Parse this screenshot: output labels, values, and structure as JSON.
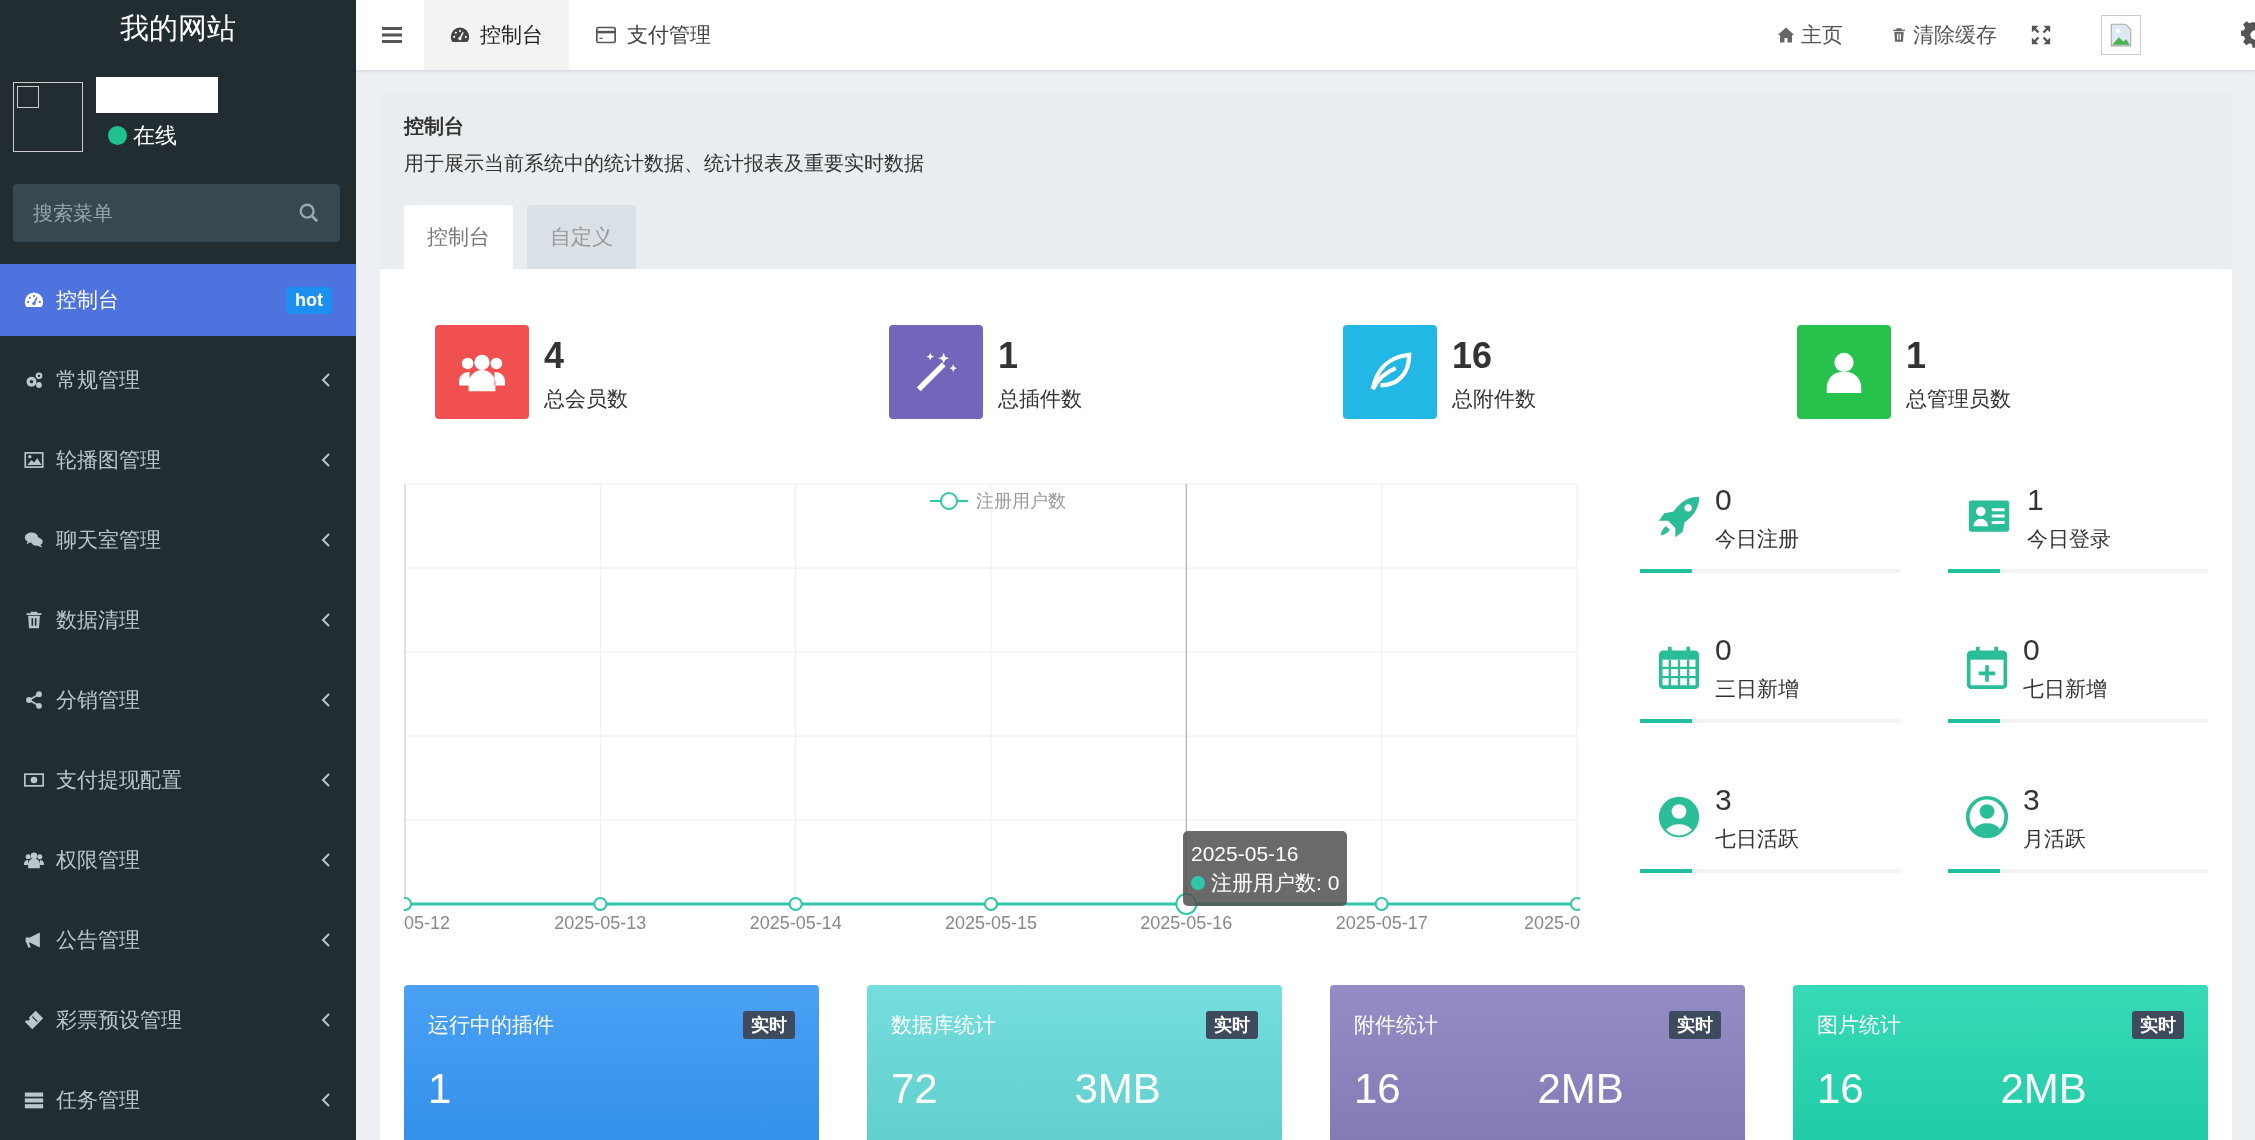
{
  "sidebar": {
    "title": "我的网站",
    "user": {
      "status": "在线"
    },
    "search": {
      "placeholder": "搜索菜单"
    },
    "items": [
      {
        "label": "控制台",
        "kind": "link",
        "badge": "hot",
        "selected": true
      },
      {
        "label": "常规管理",
        "kind": "submenu",
        "selected": false
      },
      {
        "label": "轮播图管理",
        "kind": "submenu",
        "selected": false
      },
      {
        "label": "聊天室管理",
        "kind": "submenu",
        "selected": false
      },
      {
        "label": "数据清理",
        "kind": "submenu",
        "selected": false
      },
      {
        "label": "分销管理",
        "kind": "submenu",
        "selected": false
      },
      {
        "label": "支付提现配置",
        "kind": "submenu",
        "selected": false
      },
      {
        "label": "权限管理",
        "kind": "submenu",
        "selected": false
      },
      {
        "label": "公告管理",
        "kind": "submenu",
        "selected": false
      },
      {
        "label": "彩票预设管理",
        "kind": "submenu",
        "selected": false
      },
      {
        "label": "任务管理",
        "kind": "submenu",
        "selected": false
      }
    ]
  },
  "topbar": {
    "tabs": [
      {
        "label": "控制台",
        "selected": true
      },
      {
        "label": "支付管理",
        "selected": false
      }
    ],
    "actions": [
      {
        "label": "主页"
      },
      {
        "label": "清除缓存"
      }
    ]
  },
  "panel": {
    "title": "控制台",
    "description": "用于展示当前系统中的统计数据、统计报表及重要实时数据",
    "tabs": [
      {
        "label": "控制台",
        "selected": true
      },
      {
        "label": "自定义",
        "selected": false
      }
    ],
    "stats": [
      {
        "value": "4",
        "label": "总会员数",
        "color": "#f05050"
      },
      {
        "value": "1",
        "label": "总插件数",
        "color": "#7266ba"
      },
      {
        "value": "16",
        "label": "总附件数",
        "color": "#23b7e5"
      },
      {
        "value": "1",
        "label": "总管理员数",
        "color": "#27c24c"
      }
    ],
    "chart": {
      "x_labels": [
        "05-12",
        "2025-05-13",
        "2025-05-14",
        "2025-05-15",
        "2025-05-16",
        "2025-05-17",
        "2025-0"
      ],
      "legend": "注册用户数",
      "tooltip": {
        "title": "2025-05-16",
        "label": "注册用户数: 0"
      }
    },
    "mini_stats": [
      {
        "value": "0",
        "label": "今日注册",
        "level": 0.2
      },
      {
        "value": "1",
        "label": "今日登录",
        "level": 0.2
      },
      {
        "value": "0",
        "label": "三日新增",
        "level": 0.2
      },
      {
        "value": "0",
        "label": "七日新增",
        "level": 0.2
      },
      {
        "value": "3",
        "label": "七日活跃",
        "level": 0.2
      },
      {
        "value": "3",
        "label": "月活跃",
        "level": 0.2
      }
    ],
    "cards": [
      {
        "title": "运行中的插件",
        "badge": "实时",
        "color": "#3194f4",
        "values": [
          "1"
        ]
      },
      {
        "title": "数据库统计",
        "badge": "实时",
        "color": "#62d8d8",
        "values": [
          "72",
          "3MB"
        ]
      },
      {
        "title": "附件统计",
        "badge": "实时",
        "color": "#857dbd",
        "values": [
          "16",
          "2MB"
        ]
      },
      {
        "title": "图片统计",
        "badge": "实时",
        "color": "#1cd4ad",
        "values": [
          "16",
          "2MB"
        ]
      }
    ]
  }
}
